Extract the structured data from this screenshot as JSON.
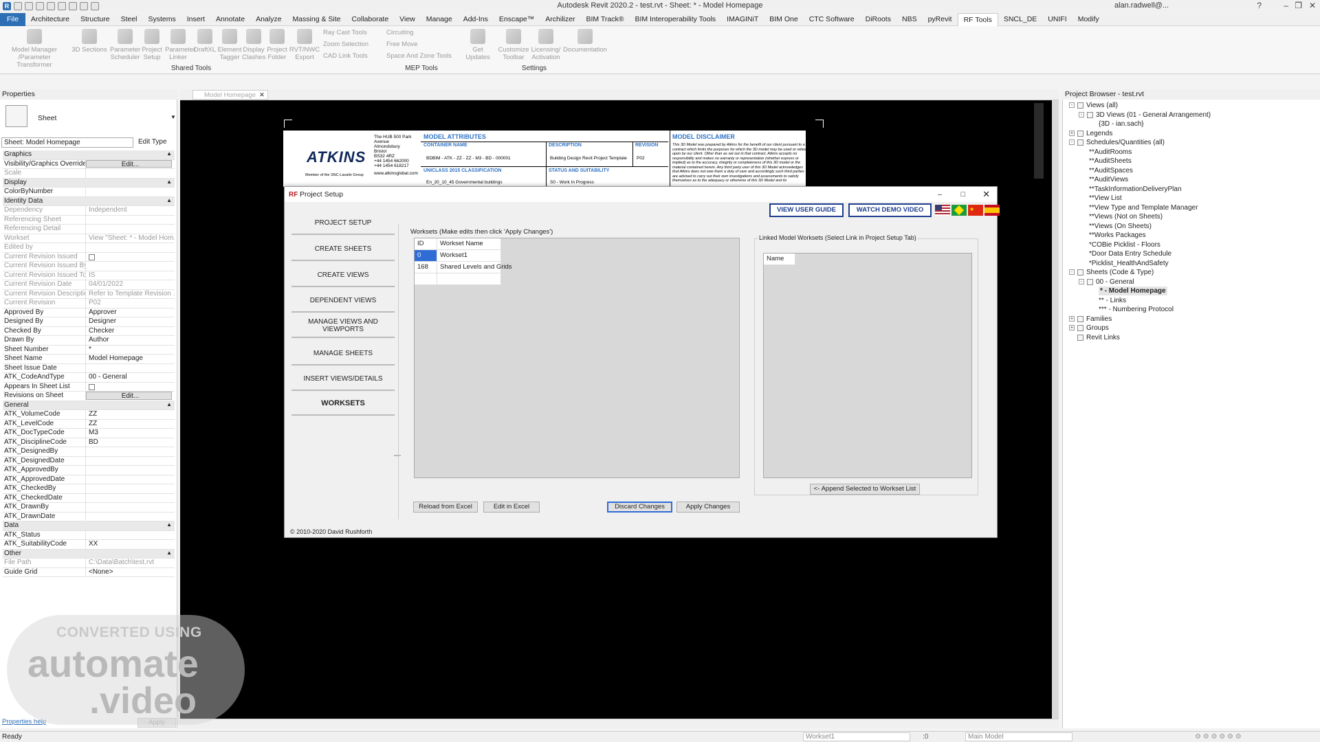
{
  "titlebar": {
    "app_title": "Autodesk Revit 2020.2 - test.rvt - Sheet: * - Model Homepage",
    "user": "alan.radwell@...",
    "help": "?"
  },
  "ribbon_tabs": [
    "File",
    "Architecture",
    "Structure",
    "Steel",
    "Systems",
    "Insert",
    "Annotate",
    "Analyze",
    "Massing & Site",
    "Collaborate",
    "View",
    "Manage",
    "Add-Ins",
    "Enscape™",
    "Archilizer",
    "BIM Track®",
    "BIM Interoperability Tools",
    "IMAGINiT",
    "BIM One",
    "CTC Software",
    "DiRoots",
    "NBS",
    "pyRevit",
    "RF Tools",
    "SNCL_DE",
    "UNIFI",
    "Modify"
  ],
  "ribbon": {
    "buttons": [
      "Model Manager /Parameter Transformer",
      "3D Sections",
      "Parameter Scheduler",
      "Project Setup",
      "Parameter Linker",
      "DraftXL",
      "Element Tagger",
      "Display Clashes",
      "Project Folder",
      "RVT/NWC Export",
      "Get Updates",
      "Customize Toolbar",
      "Licensing/ Activation",
      "Documentation"
    ],
    "small": [
      "Ray Cast Tools",
      "Zoom Selection",
      "CAD Link Tools",
      "Circuiting",
      "Free Move",
      "Space And Zone Tools"
    ],
    "panels": [
      "Shared Tools",
      "MEP Tools",
      "Settings"
    ]
  },
  "properties": {
    "title": "Properties",
    "type_name": "Sheet",
    "selector": "Sheet: Model Homepage",
    "edit_type": "Edit Type",
    "help_link": "Properties help",
    "apply": "Apply",
    "rows": [
      {
        "k": "Graphics",
        "v": "",
        "s": 1
      },
      {
        "k": "Visibility/Graphics Overrides",
        "v": "Edit...",
        "b": 1
      },
      {
        "k": "Scale",
        "v": "",
        "g": 1
      },
      {
        "k": "Display",
        "v": "",
        "s": 1
      },
      {
        "k": "ColorByNumber",
        "v": ""
      },
      {
        "k": "Identity Data",
        "v": "",
        "s": 1
      },
      {
        "k": "Dependency",
        "v": "Independent",
        "g": 1
      },
      {
        "k": "Referencing Sheet",
        "v": "",
        "g": 1
      },
      {
        "k": "Referencing Detail",
        "v": "",
        "g": 1
      },
      {
        "k": "Workset",
        "v": "View \"Sheet: * - Model Hom...",
        "g": 1
      },
      {
        "k": "Edited by",
        "v": "",
        "g": 1
      },
      {
        "k": "Current Revision Issued",
        "v": "",
        "g": 1,
        "c": 1
      },
      {
        "k": "Current Revision Issued By",
        "v": "",
        "g": 1
      },
      {
        "k": "Current Revision Issued To",
        "v": "IS",
        "g": 1
      },
      {
        "k": "Current Revision Date",
        "v": "04/01/2022",
        "g": 1
      },
      {
        "k": "Current Revision Description",
        "v": "Refer to Template Revision ...",
        "g": 1
      },
      {
        "k": "Current Revision",
        "v": "P02",
        "g": 1
      },
      {
        "k": "Approved By",
        "v": "Approver"
      },
      {
        "k": "Designed By",
        "v": "Designer"
      },
      {
        "k": "Checked By",
        "v": "Checker"
      },
      {
        "k": "Drawn By",
        "v": "Author"
      },
      {
        "k": "Sheet Number",
        "v": "*"
      },
      {
        "k": "Sheet Name",
        "v": "Model Homepage"
      },
      {
        "k": "Sheet Issue Date",
        "v": ""
      },
      {
        "k": "ATK_CodeAndType",
        "v": "00 - General"
      },
      {
        "k": "Appears In Sheet List",
        "v": "",
        "c": 1
      },
      {
        "k": "Revisions on Sheet",
        "v": "Edit...",
        "b": 1
      },
      {
        "k": "General",
        "v": "",
        "s": 1
      },
      {
        "k": "ATK_VolumeCode",
        "v": "ZZ"
      },
      {
        "k": "ATK_LevelCode",
        "v": "ZZ"
      },
      {
        "k": "ATK_DocTypeCode",
        "v": "M3"
      },
      {
        "k": "ATK_DisciplineCode",
        "v": "BD"
      },
      {
        "k": "ATK_DesignedBy",
        "v": ""
      },
      {
        "k": "ATK_DesignedDate",
        "v": ""
      },
      {
        "k": "ATK_ApprovedBy",
        "v": ""
      },
      {
        "k": "ATK_ApprovedDate",
        "v": ""
      },
      {
        "k": "ATK_CheckedBy",
        "v": ""
      },
      {
        "k": "ATK_CheckedDate",
        "v": ""
      },
      {
        "k": "ATK_DrawnBy",
        "v": ""
      },
      {
        "k": "ATK_DrawnDate",
        "v": ""
      },
      {
        "k": "Data",
        "v": "",
        "s": 1
      },
      {
        "k": "ATK_Status",
        "v": ""
      },
      {
        "k": "ATK_SuitabilityCode",
        "v": "XX"
      },
      {
        "k": "Other",
        "v": "",
        "s": 1
      },
      {
        "k": "File Path",
        "v": "C:\\Data\\Batch\\test.rvt",
        "g": 1
      },
      {
        "k": "Guide Grid",
        "v": "<None>"
      }
    ]
  },
  "doc_tab": "Model Homepage",
  "titleblock": {
    "logo": "ATKINS",
    "logo_sub": "Member of the SNC-Lavalin Group",
    "address": [
      "The HUB 500 Park",
      "Avenue",
      "Almondsbury",
      "Bristol",
      "BS32 4RZ",
      "+44 1454 662000",
      "+44 1454 618217"
    ],
    "website": "www.atkinsglobal.com",
    "model_attributes": "MODEL ATTRIBUTES",
    "container_name": "CONTAINER NAME",
    "container_value": "BDBIM - ATK - ZZ - ZZ - M3 - BD - 000001",
    "description": "DESCRIPTION",
    "description_value": "Building Design Revit Project Template",
    "revision": "REVISION",
    "revision_value": "P02",
    "uniclass": "UNICLASS 2015 CLASSIFICATION",
    "uniclass_value": "En_20_10_45 Governmental buildings",
    "status": "STATUS AND SUITABILITY",
    "status_value": "S0 - Work In Progress",
    "disclaimer": "MODEL DISCLAIMER",
    "disclaimer_text": "This 3D Model was prepared by Atkins for the benefit of our client pursuant to a contract which limits the purposes for which the 3D model may be used or relied upon by our client. Other than as set out in that contract, Atkins accepts no responsibility and makes no warranty or representation (whether express or implied) as to the accuracy, integrity or completeness of this 3D model or the material contained herein. Any third party user of this 3D Model acknowledges that Atkins does not owe them a duty of care and accordingly such third parties are advised to carry out their own investigations and assessments to satisfy themselves as to the adequacy or otherwise of this 3D Model and its"
  },
  "dialog": {
    "title": "Project Setup",
    "nav": [
      "PROJECT SETUP",
      "CREATE SHEETS",
      "CREATE VIEWS",
      "DEPENDENT VIEWS",
      "MANAGE VIEWS AND VIEWPORTS",
      "MANAGE SHEETS",
      "INSERT VIEWS/DETAILS",
      "WORKSETS"
    ],
    "view_user_guide": "VIEW USER GUIDE",
    "watch_demo": "WATCH DEMO VIDEO",
    "worksets_label": "Worksets (Make edits then click 'Apply Changes')",
    "grid_headers": [
      "ID",
      "Workset Name"
    ],
    "grid_rows": [
      [
        "0",
        "Workset1"
      ],
      [
        "168",
        "Shared Levels and Grids"
      ]
    ],
    "linked_label": "Linked Model Worksets (Select Link in Project Setup Tab)",
    "linked_header": "Name",
    "append_btn": "<- Append Selected to Workset List",
    "reload_btn": "Reload from Excel",
    "edit_btn": "Edit in Excel",
    "discard_btn": "Discard Changes",
    "apply_btn": "Apply Changes",
    "copyright": "© 2010-2020 David Rushforth"
  },
  "browser": {
    "title": "Project Browser - test.rvt",
    "nodes": [
      {
        "t": "Views (all)",
        "l": 0,
        "e": "-"
      },
      {
        "t": "3D Views (01 - General Arrangement)",
        "l": 1,
        "e": "-"
      },
      {
        "t": "{3D - ian.sach}",
        "l": 2
      },
      {
        "t": "Legends",
        "l": 0,
        "e": "+"
      },
      {
        "t": "Schedules/Quantities (all)",
        "l": 0,
        "e": "-"
      },
      {
        "t": "**AuditRooms",
        "l": 1
      },
      {
        "t": "**AuditSheets",
        "l": 1
      },
      {
        "t": "**AuditSpaces",
        "l": 1
      },
      {
        "t": "**AuditViews",
        "l": 1
      },
      {
        "t": "**TaskInformationDeliveryPlan",
        "l": 1
      },
      {
        "t": "**View List",
        "l": 1
      },
      {
        "t": "**View Type and Template Manager",
        "l": 1
      },
      {
        "t": "**Views (Not on Sheets)",
        "l": 1
      },
      {
        "t": "**Views (On Sheets)",
        "l": 1
      },
      {
        "t": "**Works Packages",
        "l": 1
      },
      {
        "t": "*COBie Picklist - Floors",
        "l": 1
      },
      {
        "t": "*Door Data Entry Schedule",
        "l": 1
      },
      {
        "t": "*Picklist_HealthAndSafety",
        "l": 1
      },
      {
        "t": "Sheets (Code & Type)",
        "l": 0,
        "e": "-"
      },
      {
        "t": "00 - General",
        "l": 1,
        "e": "-"
      },
      {
        "t": "* - Model Homepage",
        "l": 2,
        "sel": 1
      },
      {
        "t": "** - Links",
        "l": 2
      },
      {
        "t": "*** - Numbering Protocol",
        "l": 2
      },
      {
        "t": "Families",
        "l": 0,
        "e": "+"
      },
      {
        "t": "Groups",
        "l": 0,
        "e": "+"
      },
      {
        "t": "Revit Links",
        "l": 0
      }
    ]
  },
  "status": {
    "ready": "Ready",
    "workset": "Workset1",
    "count": ":0",
    "model": "Main Model"
  },
  "watermark": {
    "line1": "CONVERTED USING",
    "line2": "automate",
    "line3": ".video"
  }
}
